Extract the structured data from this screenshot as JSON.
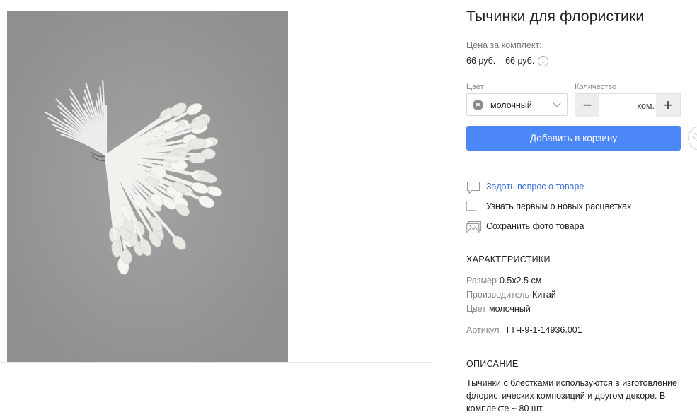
{
  "product": {
    "title": "Тычинки для флористики",
    "price_label": "Цена за комплект:",
    "price_value": "66 руб. – 66 руб.",
    "info_glyph": "i"
  },
  "options": {
    "color_label": "Цвет",
    "color_value": "молочный",
    "quantity_label": "Количество",
    "quantity_unit": "ком.",
    "minus": "−",
    "plus": "+"
  },
  "cart_button": "Добавить в корзину",
  "actions": {
    "ask": "Задать вопрос о товаре",
    "notify": "Узнать первым о новых расцветках",
    "save_photo": "Сохранить фото товара"
  },
  "characteristics": {
    "heading": "ХАРАКТЕРИСТИКИ",
    "rows": [
      {
        "key": "Размер",
        "value": "0.5x2.5 см"
      },
      {
        "key": "Производитель",
        "value": "Китай"
      },
      {
        "key": "Цвет",
        "value": "молочный"
      }
    ],
    "article_key": "Артикул",
    "article_value": "ТТЧ-9-1-14936.001"
  },
  "description": {
    "heading": "ОПИСАНИЕ",
    "text": "Тычинки с блестками используются в изготовление флористических композиций и другом декоре. В комплекте ~ 80 шт."
  },
  "icons": {
    "ask": "speech-bubble-icon",
    "notify": "checkbox",
    "save": "photo-icon",
    "favorite": "heart-icon",
    "color_select": "chevron-down-icon"
  },
  "colors": {
    "accent": "#4b87f7",
    "link": "#3a6fd8",
    "photo_background": "#959595"
  }
}
